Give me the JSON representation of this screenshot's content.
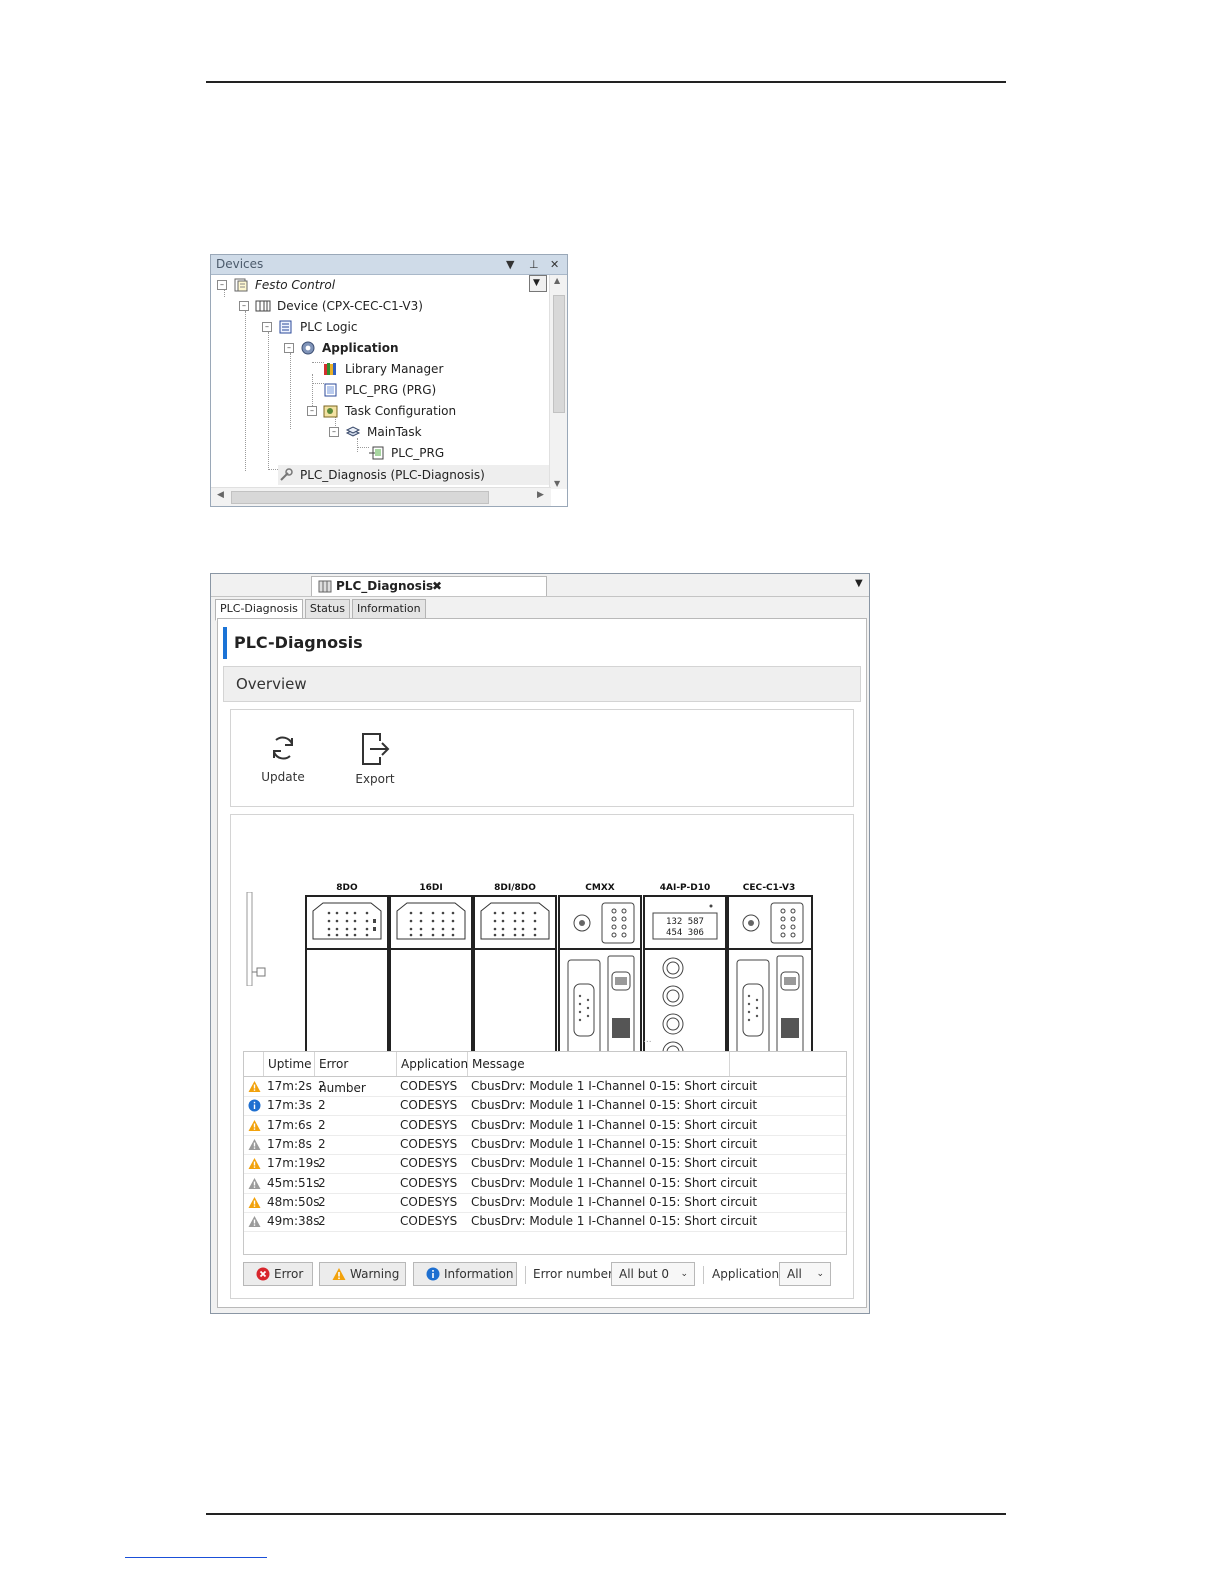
{
  "devices_panel": {
    "title": "Devices",
    "tree": [
      {
        "label": "Festo Control",
        "italic": true,
        "bold": false
      },
      {
        "label": "Device (CPX-CEC-C1-V3)",
        "italic": false,
        "bold": false
      },
      {
        "label": "PLC Logic",
        "italic": false,
        "bold": false
      },
      {
        "label": "Application",
        "italic": false,
        "bold": true
      },
      {
        "label": "Library Manager",
        "italic": false,
        "bold": false
      },
      {
        "label": "PLC_PRG (PRG)",
        "italic": false,
        "bold": false
      },
      {
        "label": "Task Configuration",
        "italic": false,
        "bold": false
      },
      {
        "label": "MainTask",
        "italic": false,
        "bold": false
      },
      {
        "label": "PLC_PRG",
        "italic": false,
        "bold": false
      },
      {
        "label": "PLC_Diagnosis (PLC-Diagnosis)",
        "italic": false,
        "bold": false
      }
    ]
  },
  "editor": {
    "document_tab": "PLC_Diagnosis",
    "sub_tabs": [
      "PLC-Diagnosis",
      "Status",
      "Information"
    ],
    "page_title": "PLC-Diagnosis",
    "section_header": "Overview",
    "toolbar": {
      "update_label": "Update",
      "export_label": "Export"
    },
    "modules": [
      "8DO",
      "16DI",
      "8DI/8DO",
      "CMXX",
      "4AI-P-D10",
      "CEC-C1-V3"
    ],
    "display_top": "132  587",
    "display_bottom": "454  306",
    "table": {
      "columns": [
        "Uptime",
        "Error number",
        "Application",
        "Message"
      ],
      "rows": [
        {
          "severity": "warning",
          "uptime": "17m:2s",
          "error_number": "2",
          "application": "CODESYS",
          "message": "CbusDrv: Module 1 I-Channel 0-15: Short circuit"
        },
        {
          "severity": "info",
          "uptime": "17m:3s",
          "error_number": "2",
          "application": "CODESYS",
          "message": "CbusDrv: Module 1 I-Channel 0-15: Short circuit"
        },
        {
          "severity": "warning",
          "uptime": "17m:6s",
          "error_number": "2",
          "application": "CODESYS",
          "message": "CbusDrv: Module 1 I-Channel 0-15: Short circuit"
        },
        {
          "severity": "warning-gray",
          "uptime": "17m:8s",
          "error_number": "2",
          "application": "CODESYS",
          "message": "CbusDrv: Module 1 I-Channel 0-15: Short circuit"
        },
        {
          "severity": "warning",
          "uptime": "17m:19s",
          "error_number": "2",
          "application": "CODESYS",
          "message": "CbusDrv: Module 1 I-Channel 0-15: Short circuit"
        },
        {
          "severity": "warning-gray",
          "uptime": "45m:51s",
          "error_number": "2",
          "application": "CODESYS",
          "message": "CbusDrv: Module 1 I-Channel 0-15: Short circuit"
        },
        {
          "severity": "warning",
          "uptime": "48m:50s",
          "error_number": "2",
          "application": "CODESYS",
          "message": "CbusDrv: Module 1 I-Channel 0-15: Short circuit"
        },
        {
          "severity": "warning-gray",
          "uptime": "49m:38s",
          "error_number": "2",
          "application": "CODESYS",
          "message": "CbusDrv: Module 1 I-Channel 0-15: Short circuit"
        }
      ]
    },
    "filters": {
      "error_button": "Error",
      "warning_button": "Warning",
      "information_button": "Information",
      "error_number_label": "Error number",
      "error_number_value": "All but 0",
      "application_label": "Application",
      "application_value": "All"
    }
  },
  "colors": {
    "accent_blue": "#1b73d6",
    "warning_orange": "#f2a20c",
    "warning_gray": "#9a9a9a",
    "error_red": "#d8262d",
    "info_blue": "#1e6fd0",
    "panel_title_bg": "#cfdbe8"
  }
}
